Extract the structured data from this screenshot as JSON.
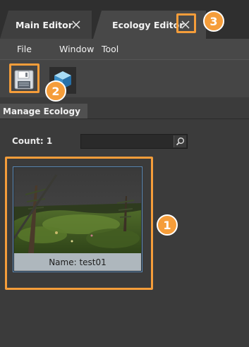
{
  "tabs": [
    {
      "label": "Main Editor",
      "close_icon": "close-icon"
    },
    {
      "label": "Ecology Editor",
      "close_icon": "close-icon"
    }
  ],
  "menu": [
    {
      "label": "File"
    },
    {
      "label": "Window"
    },
    {
      "label": "Tool"
    }
  ],
  "toolbar": {
    "save_icon": "floppy-disk-icon",
    "cube_icon": "cube-icon"
  },
  "section": {
    "title": "Manage Ecology"
  },
  "list": {
    "count_label": "Count: 1",
    "search_value": "",
    "search_icon": "magnifier-icon"
  },
  "items": [
    {
      "name": "Name: test01"
    }
  ],
  "callouts": {
    "badge_1": "1",
    "badge_2": "2",
    "badge_3": "3",
    "accent": "#f59d3a"
  },
  "colors": {
    "selection_border": "#5a8ab8",
    "name_bar": "#aeb7bd"
  }
}
